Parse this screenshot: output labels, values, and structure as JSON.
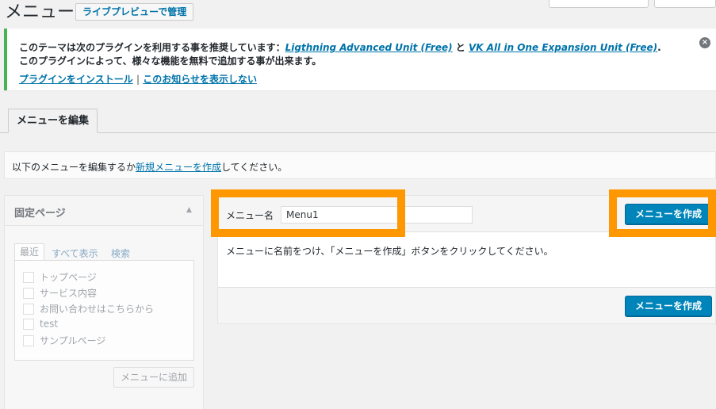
{
  "header": {
    "title": "メニュー",
    "live_preview_button": "ライブプレビューで管理"
  },
  "notice": {
    "line1_prefix": "このテーマは次のプラグインを利用する事を推奨しています：",
    "plugin1": "Ligthning Advanced Unit (Free)",
    "and": "と",
    "plugin2": "VK All in One Expansion Unit (Free)",
    "period": ".",
    "line2": "このプラグインによって、様々な機能を無料で追加する事が出来ます。",
    "install_link": "プラグインをインストール",
    "separator": "|",
    "hide_link": "このお知らせを表示しない",
    "dismiss_icon": "×"
  },
  "tabs": {
    "edit_menus": "メニューを編集"
  },
  "manage": {
    "prefix": "以下のメニューを編集するか",
    "link": "新規メニューを作成",
    "suffix": "してください。"
  },
  "pages_panel": {
    "title": "固定ページ",
    "arrow": "▲",
    "tab_recent": "最近",
    "tab_all": "すべて表示",
    "tab_search": "検索",
    "items": [
      "トップページ",
      "サービス内容",
      "お問い合わせはこちらから",
      "test",
      "サンプルページ"
    ],
    "add_button": "メニューに追加"
  },
  "menu_editor": {
    "name_label": "メニュー名",
    "name_value": "Menu1",
    "create_button": "メニューを作成",
    "instructions": "メニューに名前をつけ、「メニューを作成」ボタンをクリックしてください。",
    "create_button_bottom": "メニューを作成"
  },
  "colors": {
    "highlight": "#ff9800",
    "primary": "#0085ba",
    "notice_border": "#46b450",
    "link": "#0073aa"
  }
}
